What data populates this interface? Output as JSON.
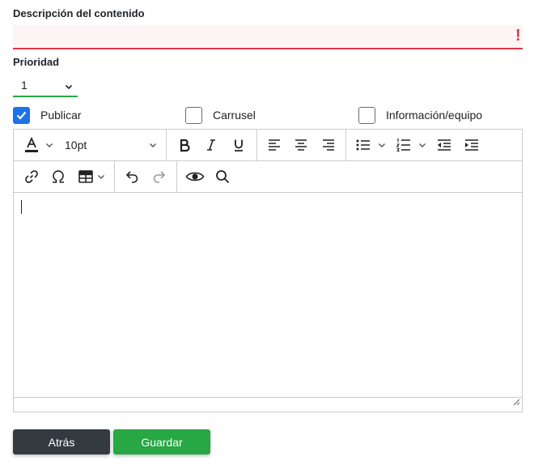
{
  "form": {
    "description": {
      "label": "Descripción del contenido",
      "value": "",
      "error_icon": "!",
      "border_color": "#dc3545"
    },
    "priority": {
      "label": "Prioridad",
      "value": "1",
      "border_color": "#28a745"
    },
    "checkboxes": [
      {
        "label": "Publicar",
        "checked": true
      },
      {
        "label": "Carrusel",
        "checked": false
      },
      {
        "label": "Información/equipo",
        "checked": false
      }
    ]
  },
  "editor": {
    "font_size": "10pt",
    "toolbar_icons": [
      "text-color-icon",
      "font-size-dropdown",
      "bold-icon",
      "italic-icon",
      "underline-icon",
      "align-left-icon",
      "align-center-icon",
      "align-right-icon",
      "bullet-list-icon",
      "numbered-list-icon",
      "outdent-icon",
      "indent-icon",
      "link-icon",
      "special-char-icon",
      "table-icon",
      "undo-icon",
      "redo-icon",
      "preview-icon",
      "search-icon"
    ],
    "content": ""
  },
  "actions": {
    "back_label": "Atrás",
    "save_label": "Guardar"
  },
  "colors": {
    "accent_blue": "#1a73e8",
    "success_green": "#28a745",
    "error_red": "#dc3545",
    "dark_button": "#343a40"
  }
}
